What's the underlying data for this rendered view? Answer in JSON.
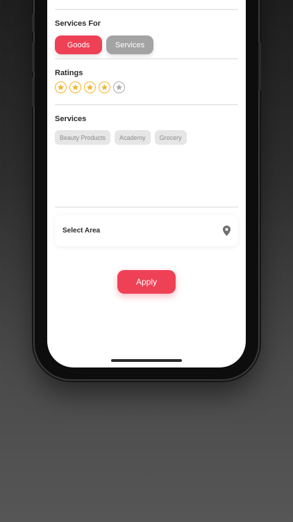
{
  "services_for": {
    "title": "Services For",
    "options": [
      {
        "label": "Goods",
        "selected": true
      },
      {
        "label": "Services",
        "selected": false
      }
    ]
  },
  "ratings": {
    "title": "Ratings",
    "value": 4,
    "max": 5
  },
  "services": {
    "title": "Services",
    "chips": [
      "Beauty Products",
      "Academy",
      "Grocery"
    ]
  },
  "area": {
    "label": "Select Area",
    "icon": "location-pin-icon"
  },
  "apply_label": "Apply",
  "colors": {
    "accent": "#ef4156",
    "inactive_pill": "#a3a3a3",
    "star_active": "#f0b429",
    "star_inactive": "#a9a9a9",
    "chip_bg": "#e6e6e6"
  }
}
